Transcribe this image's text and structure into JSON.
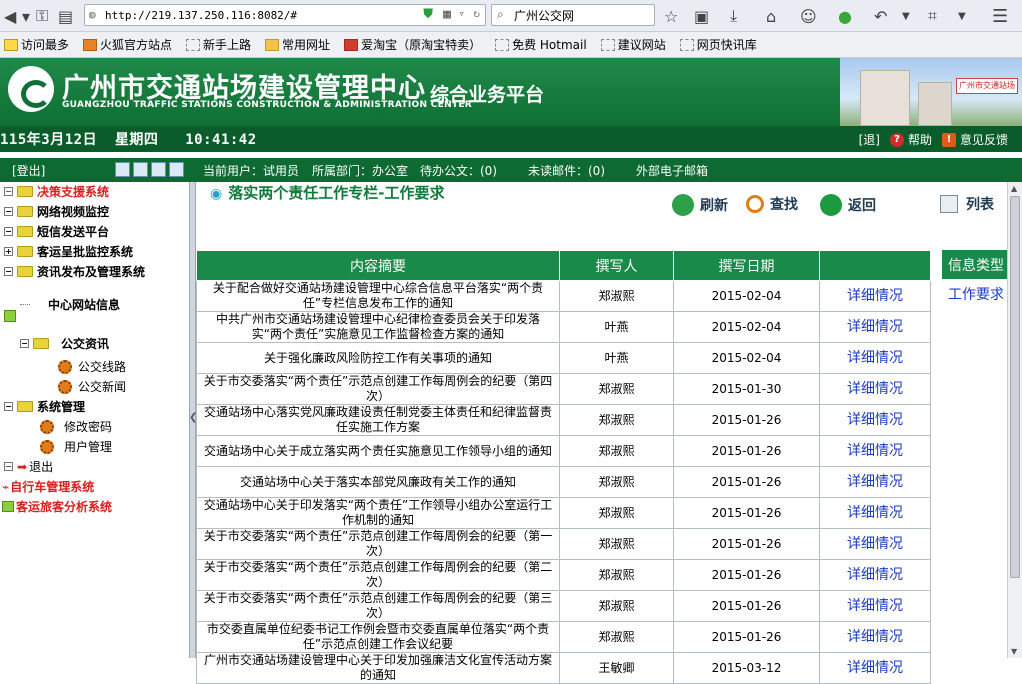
{
  "browser": {
    "url": "http://219.137.250.116:8082/#",
    "search_value": "广州公交网",
    "bookmarks": [
      {
        "label": "访问最多"
      },
      {
        "label": "火狐官方站点"
      },
      {
        "label": "新手上路"
      },
      {
        "label": "常用网址"
      },
      {
        "label": "爱淘宝（原淘宝特卖）"
      },
      {
        "label": "免费 Hotmail"
      },
      {
        "label": "建议网站"
      },
      {
        "label": "网页快讯库"
      }
    ]
  },
  "header": {
    "org_name": "广州市交通站场建设管理中心",
    "org_name_en": "GUANGZHOU TRAFFIC STATIONS CONSTRUCTION & ADMINISTRATION CENTER",
    "platform": "综合业务平台",
    "date": "115年3月12日",
    "weekday": "星期四",
    "time": "10:41:42",
    "exit_label": "[退]",
    "help_label": "帮助",
    "feedback_label": "意见反馈"
  },
  "infobar": {
    "logout": "[登出]",
    "current_user": "当前用户：试用员",
    "department": "所属部门：办公室",
    "pending_docs": "待办公文：(0)",
    "unread_mail": "未读邮件：(0)",
    "external_mail": "外部电子邮箱"
  },
  "sidebar": {
    "items": [
      {
        "label": "决策支援系统"
      },
      {
        "label": "网络视频监控"
      },
      {
        "label": "短信发送平台"
      },
      {
        "label": "客运呈批监控系统"
      },
      {
        "label": "资讯发布及管理系统"
      },
      {
        "label": "中心网站信息"
      },
      {
        "label": "公交资讯"
      },
      {
        "label": "公交线路"
      },
      {
        "label": "公交新闻"
      },
      {
        "label": "系统管理"
      },
      {
        "label": "修改密码"
      },
      {
        "label": "用户管理"
      },
      {
        "label": "退出"
      },
      {
        "label": "自行车管理系统"
      },
      {
        "label": "客运旅客分析系统"
      }
    ]
  },
  "main": {
    "title": "落实两个责任工作专栏-工作要求",
    "actions": {
      "refresh": "刷新",
      "search": "查找",
      "back": "返回",
      "list": "列表"
    },
    "table": {
      "headers": [
        "内容摘要",
        "撰写人",
        "撰写日期",
        ""
      ],
      "detail_label": "详细情况",
      "rows": [
        {
          "summary": "关于配合做好交通站场建设管理中心综合信息平台落实“两个责任”专栏信息发布工作的通知",
          "author": "郑淑熙",
          "date": "2015-02-04"
        },
        {
          "summary": "中共广州市交通站场建设管理中心纪律检查委员会关于印发落实“两个责任”实施意见工作监督检查方案的通知",
          "author": "叶燕",
          "date": "2015-02-04"
        },
        {
          "summary": "关于强化廉政风险防控工作有关事项的通知",
          "author": "叶燕",
          "date": "2015-02-04"
        },
        {
          "summary": "关于市交委落实“两个责任”示范点创建工作每周例会的纪要（第四次）",
          "author": "郑淑熙",
          "date": "2015-01-30"
        },
        {
          "summary": "交通站场中心落实党风廉政建设责任制党委主体责任和纪律监督责任实施工作方案",
          "author": "郑淑熙",
          "date": "2015-01-26"
        },
        {
          "summary": "交通站场中心关于成立落实两个责任实施意见工作领导小组的通知",
          "author": "郑淑熙",
          "date": "2015-01-26"
        },
        {
          "summary": "交通站场中心关于落实本部党风廉政有关工作的通知",
          "author": "郑淑熙",
          "date": "2015-01-26"
        },
        {
          "summary": "交通站场中心关于印发落实“两个责任”工作领导小组办公室运行工作机制的通知",
          "author": "郑淑熙",
          "date": "2015-01-26"
        },
        {
          "summary": "关于市交委落实“两个责任”示范点创建工作每周例会的纪要（第一次）",
          "author": "郑淑熙",
          "date": "2015-01-26"
        },
        {
          "summary": "关于市交委落实“两个责任”示范点创建工作每周例会的纪要（第二次）",
          "author": "郑淑熙",
          "date": "2015-01-26"
        },
        {
          "summary": "关于市交委落实“两个责任”示范点创建工作每周例会的纪要（第三次）",
          "author": "郑淑熙",
          "date": "2015-01-26"
        },
        {
          "summary": "市交委直属单位纪委书记工作例会暨市交委直属单位落实“两个责任”示范点创建工作会议纪要",
          "author": "郑淑熙",
          "date": "2015-01-26"
        },
        {
          "summary": "广州市交通站场建设管理中心关于印发加强廉洁文化宣传活动方案的通知",
          "author": "王敏卿",
          "date": "2015-03-12"
        }
      ]
    },
    "side_panel": {
      "header": "信息类型",
      "link": "工作要求"
    }
  }
}
